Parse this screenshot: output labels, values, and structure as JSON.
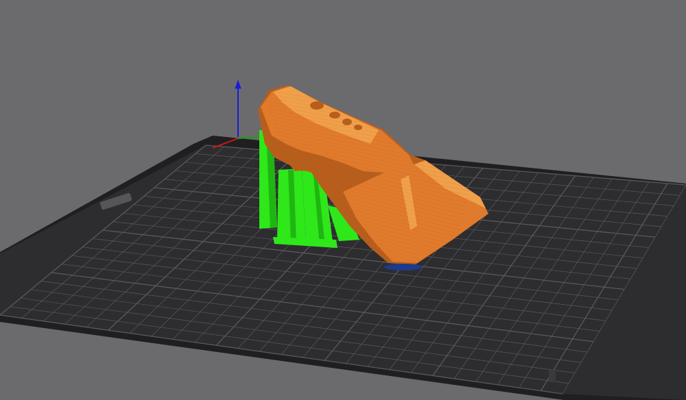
{
  "viewport": {
    "background_color": "#6b6b6e"
  },
  "bed": {
    "surface_color": "#2d2d30",
    "edge_color": "#1f1f21",
    "grid_color": "#5a5a5e",
    "grid_columns": 26,
    "grid_rows": 20,
    "label_plate_icon": "bed-label-plate"
  },
  "axes": {
    "z_color": "#1a1ad8",
    "x_color": "#d01818",
    "y_color": "#18a018"
  },
  "model": {
    "color": "#e07a2c",
    "highlight_color": "#f0a04a",
    "shadow_color": "#b85e1c"
  },
  "supports": {
    "color": "#2ee81a",
    "shade_color": "#1fb612"
  },
  "first_layer": {
    "color": "#1e3a8a"
  }
}
